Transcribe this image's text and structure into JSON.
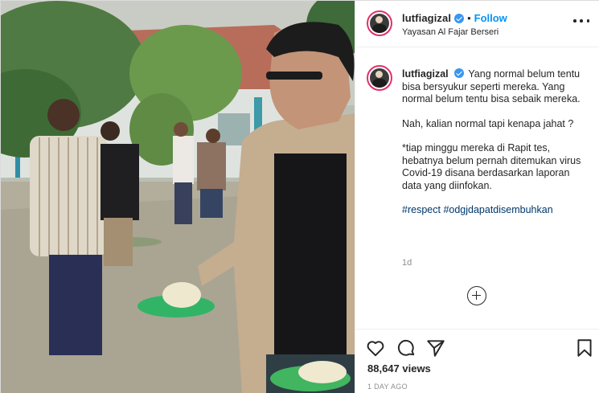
{
  "post": {
    "username": "lutfiagizal",
    "verified": true,
    "follow_label": "Follow",
    "separator": "•",
    "location": "Yayasan Al Fajar Berseri",
    "more_icon": "more-horizontal-icon"
  },
  "caption": {
    "username": "lutfiagizal",
    "paragraphs": [
      "Yang normal belum tentu bisa bersyukur seperti mereka. Yang normal belum tentu bisa sebaik mereka.",
      "Nah, kalian normal tapi kenapa jahat ?",
      "*tiap minggu mereka di Rapit tes, hebatnya belum pernah ditemukan virus Covid-19 disana berdasarkan laporan data yang diinfokan."
    ],
    "hashtags": [
      "#respect",
      "#odgjdapatdisembuhkan"
    ],
    "age": "1d"
  },
  "comments": {
    "load_more_icon": "plus-circle-icon"
  },
  "actions": {
    "like_icon": "heart-icon",
    "comment_icon": "comment-icon",
    "share_icon": "paper-plane-icon",
    "save_icon": "bookmark-icon"
  },
  "stats": {
    "views": "88,647 views",
    "time": "1 DAY AGO"
  },
  "colors": {
    "link_blue": "#0095f6",
    "verified_blue": "#3897f0",
    "hashtag": "#00376b",
    "muted": "#8e8e8e",
    "text": "#262626"
  }
}
